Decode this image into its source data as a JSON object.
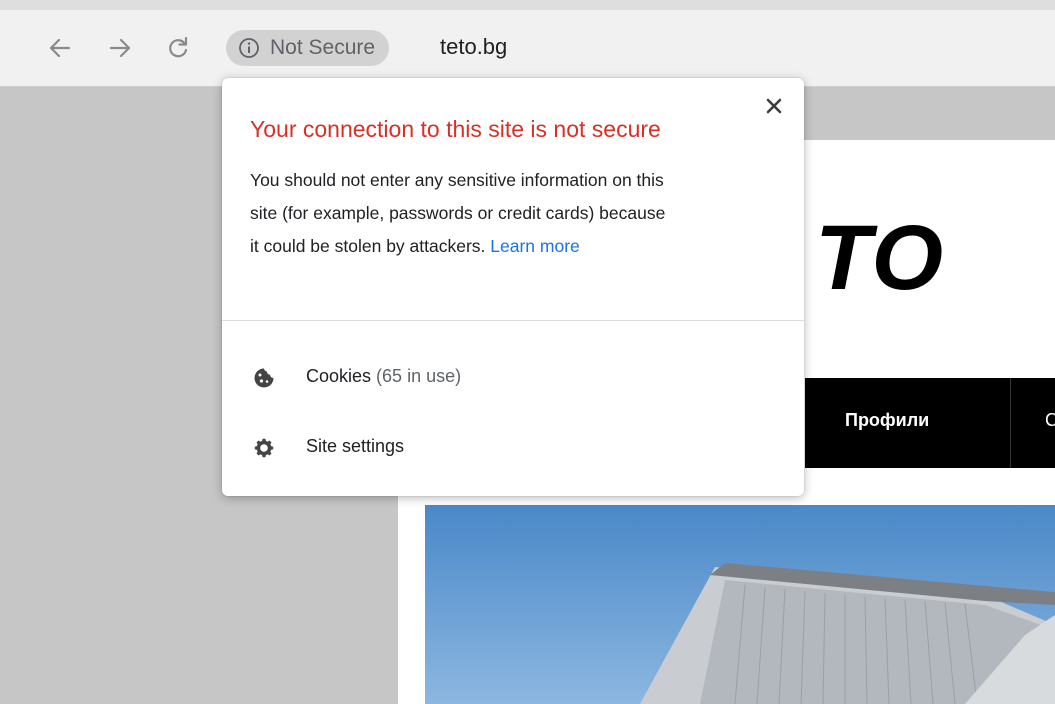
{
  "browser": {
    "security_label": "Not Secure",
    "url": "teto.bg"
  },
  "popup": {
    "title": "Your connection to this site is not secure",
    "body_line1": "You should not enter any sensitive information on this",
    "body_line2": "site (for example, passwords or credit cards) because",
    "body_line3": "it could be stolen by attackers.",
    "learn_more": "Learn more",
    "cookies_label": "Cookies",
    "cookies_count": "(65 in use)",
    "site_settings_label": "Site settings"
  },
  "site": {
    "logo_text": "TO",
    "nav_item": "Профили",
    "nav_item_next": "С"
  },
  "colors": {
    "warning_red": "#d93025",
    "link_blue": "#1a73e8",
    "chip_gray": "#d2d2d2"
  }
}
